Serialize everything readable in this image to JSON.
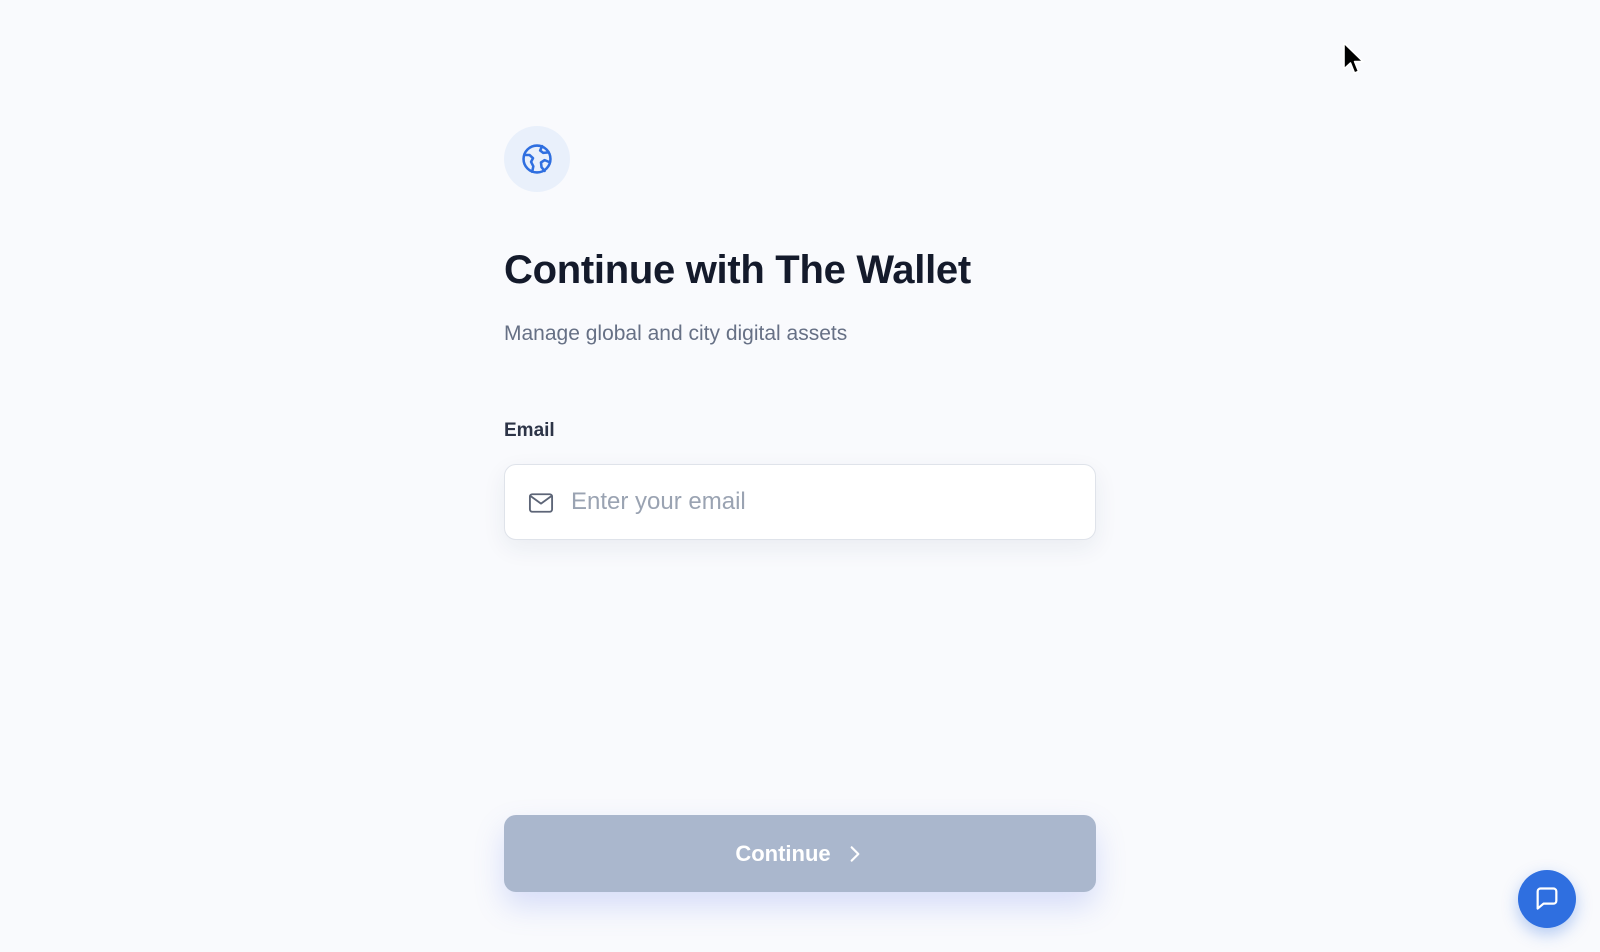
{
  "brand": {
    "icon": "globe-icon",
    "icon_color": "#2f6fe0",
    "badge_color": "#e9f0fb"
  },
  "header": {
    "title": "Continue with The Wallet",
    "subtitle": "Manage global and city digital assets"
  },
  "form": {
    "email_label": "Email",
    "email_icon": "mail-icon",
    "email_placeholder": "Enter your email",
    "email_value": ""
  },
  "actions": {
    "continue_label": "Continue",
    "continue_icon": "chevron-right-icon",
    "continue_disabled": true,
    "continue_color": "#aab7cd"
  },
  "support": {
    "chat_icon": "chat-bubble-icon",
    "chat_color": "#2f6fe0"
  }
}
